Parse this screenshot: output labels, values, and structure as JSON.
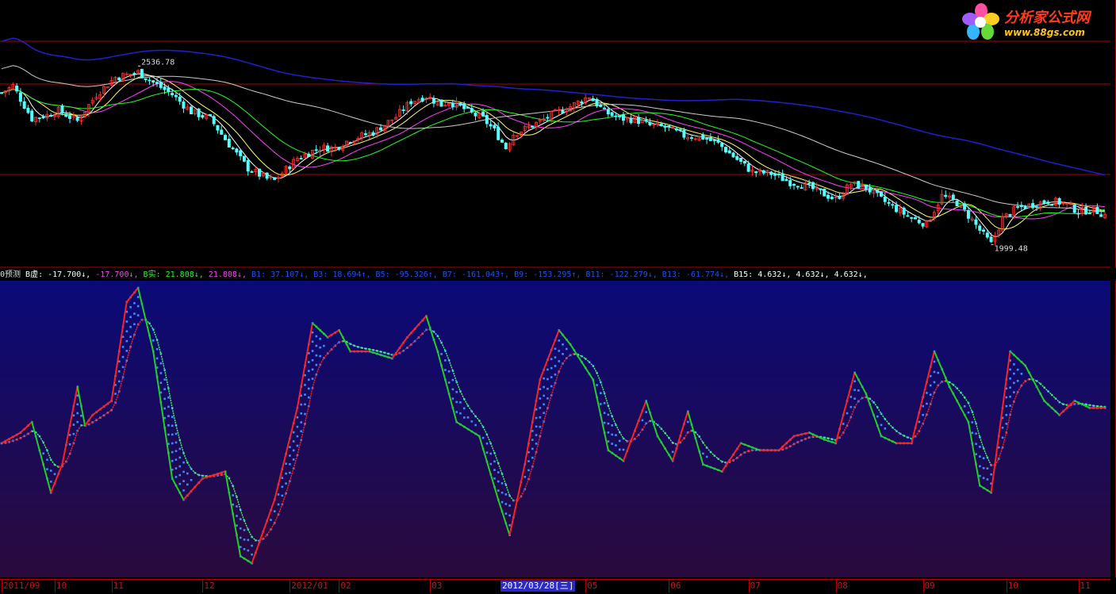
{
  "brand": {
    "name": "分析家公式网",
    "url": "www.88gs.com"
  },
  "colors": {
    "grid_red": "#b00000",
    "candle_up": "#ff3030",
    "candle_down": "#54ffff",
    "ma_white": "#ffffff",
    "ma_yellow": "#ffff66",
    "ma_magenta": "#ff40ff",
    "ma_green": "#20ff20",
    "ma_gray": "#cccccc",
    "ma_blue": "#2020d0",
    "osc_red": "#ff2020",
    "osc_green": "#20d020",
    "osc_dots": "#3a8cff",
    "panel_top": "#0a0a78",
    "panel_bottom": "#2a0a3c",
    "date_highlight": "#2a2ac8"
  },
  "indicator": {
    "items": [
      {
        "text": "0预测",
        "color": "#dddddd"
      },
      {
        "text": " B虚: -17.700↓,",
        "color": "#ffffff"
      },
      {
        "text": " -17.700↓,",
        "color": "#ff40ff"
      },
      {
        "text": " B实: 21.808↓,",
        "color": "#20ff20"
      },
      {
        "text": " 21.808↓,",
        "color": "#ff40ff"
      },
      {
        "text": " B1: 37.107↓,",
        "color": "#2050ff"
      },
      {
        "text": " B3: 18.694↑,",
        "color": "#2050ff"
      },
      {
        "text": " B5: -95.326↑,",
        "color": "#2050ff"
      },
      {
        "text": " B7: -161.043↑,",
        "color": "#2050ff"
      },
      {
        "text": " B9: -153.295↑,",
        "color": "#2050ff"
      },
      {
        "text": " B11: -122.279↓,",
        "color": "#2050ff"
      },
      {
        "text": " B13: -61.774↓,",
        "color": "#2050ff"
      },
      {
        "text": " B15: 4.632↓,",
        "color": "#ffffff"
      },
      {
        "text": " 4.632↓,",
        "color": "#ffffff"
      },
      {
        "text": " 4.632↓,",
        "color": "#ffffff"
      }
    ]
  },
  "dates": {
    "ticks": [
      {
        "label": "2011/09",
        "idx": 0
      },
      {
        "label": "10",
        "idx": 14
      },
      {
        "label": "11",
        "idx": 29
      },
      {
        "label": "12",
        "idx": 53
      },
      {
        "label": "2012/01",
        "idx": 76
      },
      {
        "label": "02",
        "idx": 89
      },
      {
        "label": "03",
        "idx": 113
      },
      {
        "label": "05",
        "idx": 154
      },
      {
        "label": "06",
        "idx": 176
      },
      {
        "label": "07",
        "idx": 197
      },
      {
        "label": "08",
        "idx": 220
      },
      {
        "label": "09",
        "idx": 243
      },
      {
        "label": "10",
        "idx": 265
      },
      {
        "label": "11",
        "idx": 284
      }
    ],
    "selected": {
      "label": "2012/03/28[三]",
      "idx": 132
    }
  },
  "chart_data": [
    {
      "type": "candlestick",
      "title": "",
      "annotations": [
        {
          "text": "2536.78",
          "kind": "high",
          "idx": 36
        },
        {
          "text": "1999.48",
          "kind": "low",
          "idx": 261
        }
      ],
      "ylim": [
        1940,
        2720
      ],
      "anchors": [
        [
          0,
          2450
        ],
        [
          3,
          2470
        ],
        [
          8,
          2375
        ],
        [
          12,
          2385
        ],
        [
          15,
          2398
        ],
        [
          20,
          2368
        ],
        [
          25,
          2445
        ],
        [
          30,
          2495
        ],
        [
          36,
          2510
        ],
        [
          40,
          2480
        ],
        [
          45,
          2445
        ],
        [
          50,
          2395
        ],
        [
          55,
          2375
        ],
        [
          60,
          2300
        ],
        [
          65,
          2230
        ],
        [
          70,
          2200
        ],
        [
          72,
          2195
        ],
        [
          78,
          2260
        ],
        [
          84,
          2290
        ],
        [
          88,
          2290
        ],
        [
          92,
          2315
        ],
        [
          98,
          2335
        ],
        [
          104,
          2380
        ],
        [
          108,
          2425
        ],
        [
          112,
          2440
        ],
        [
          116,
          2415
        ],
        [
          118,
          2425
        ],
        [
          121,
          2410
        ],
        [
          124,
          2390
        ],
        [
          127,
          2375
        ],
        [
          130,
          2340
        ],
        [
          133,
          2290
        ],
        [
          135,
          2330
        ],
        [
          140,
          2355
        ],
        [
          145,
          2385
        ],
        [
          150,
          2410
        ],
        [
          155,
          2440
        ],
        [
          159,
          2395
        ],
        [
          163,
          2375
        ],
        [
          167,
          2373
        ],
        [
          171,
          2355
        ],
        [
          175,
          2350
        ],
        [
          180,
          2325
        ],
        [
          185,
          2320
        ],
        [
          189,
          2302
        ],
        [
          193,
          2265
        ],
        [
          198,
          2220
        ],
        [
          203,
          2215
        ],
        [
          208,
          2190
        ],
        [
          212,
          2180
        ],
        [
          216,
          2160
        ],
        [
          220,
          2140
        ],
        [
          224,
          2185
        ],
        [
          228,
          2175
        ],
        [
          232,
          2140
        ],
        [
          236,
          2112
        ],
        [
          240,
          2085
        ],
        [
          244,
          2068
        ],
        [
          248,
          2150
        ],
        [
          252,
          2130
        ],
        [
          256,
          2080
        ],
        [
          258,
          2050
        ],
        [
          261,
          2010
        ],
        [
          264,
          2085
        ],
        [
          268,
          2115
        ],
        [
          272,
          2125
        ],
        [
          276,
          2135
        ],
        [
          280,
          2130
        ],
        [
          284,
          2105
        ],
        [
          288,
          2110
        ],
        [
          291,
          2095
        ]
      ],
      "moving_averages": [
        {
          "color": "#ffffff",
          "period": 5
        },
        {
          "color": "#ffff66",
          "period": 10
        },
        {
          "color": "#ff40ff",
          "period": 20
        },
        {
          "color": "#20ff20",
          "period": 30
        },
        {
          "color": "#cccccc",
          "period": 60
        },
        {
          "color": "#2020d0",
          "period": 120
        }
      ]
    },
    {
      "type": "line",
      "ylim": [
        -260,
        160
      ],
      "anchors_fast": [
        [
          0,
          -70
        ],
        [
          5,
          -55
        ],
        [
          8,
          -40
        ],
        [
          13,
          -140
        ],
        [
          16,
          -100
        ],
        [
          20,
          10
        ],
        [
          22,
          -45
        ],
        [
          24,
          -30
        ],
        [
          29,
          -10
        ],
        [
          33,
          130
        ],
        [
          36,
          150
        ],
        [
          40,
          60
        ],
        [
          45,
          -120
        ],
        [
          48,
          -150
        ],
        [
          53,
          -120
        ],
        [
          59,
          -110
        ],
        [
          63,
          -230
        ],
        [
          66,
          -240
        ],
        [
          72,
          -150
        ],
        [
          78,
          -20
        ],
        [
          82,
          100
        ],
        [
          86,
          80
        ],
        [
          89,
          90
        ],
        [
          92,
          60
        ],
        [
          97,
          60
        ],
        [
          103,
          50
        ],
        [
          107,
          80
        ],
        [
          112,
          110
        ],
        [
          115,
          60
        ],
        [
          120,
          -40
        ],
        [
          126,
          -60
        ],
        [
          131,
          -150
        ],
        [
          134,
          -200
        ],
        [
          138,
          -100
        ],
        [
          142,
          20
        ],
        [
          147,
          90
        ],
        [
          150,
          70
        ],
        [
          156,
          20
        ],
        [
          160,
          -80
        ],
        [
          164,
          -95
        ],
        [
          170,
          -10
        ],
        [
          173,
          -60
        ],
        [
          177,
          -95
        ],
        [
          181,
          -25
        ],
        [
          185,
          -100
        ],
        [
          190,
          -110
        ],
        [
          195,
          -70
        ],
        [
          200,
          -80
        ],
        [
          205,
          -80
        ],
        [
          209,
          -60
        ],
        [
          213,
          -55
        ],
        [
          217,
          -65
        ],
        [
          220,
          -70
        ],
        [
          225,
          30
        ],
        [
          228,
          0
        ],
        [
          232,
          -60
        ],
        [
          236,
          -70
        ],
        [
          240,
          -70
        ],
        [
          246,
          60
        ],
        [
          250,
          10
        ],
        [
          255,
          -40
        ],
        [
          258,
          -130
        ],
        [
          261,
          -140
        ],
        [
          266,
          60
        ],
        [
          270,
          40
        ],
        [
          275,
          -10
        ],
        [
          279,
          -30
        ],
        [
          283,
          -10
        ],
        [
          287,
          -20
        ],
        [
          291,
          -20
        ]
      ]
    }
  ]
}
